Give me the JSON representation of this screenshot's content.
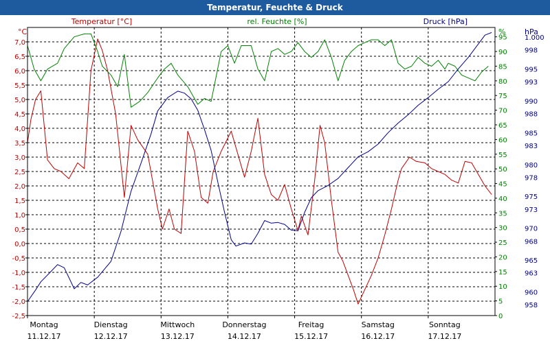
{
  "window_title": "Temperatur, Feuchte & Druck",
  "chart_data": {
    "type": "line",
    "title": "Temperatur, Feuchte & Druck",
    "grid": true,
    "x_range": [
      0,
      7
    ],
    "days": [
      {
        "name": "Montag",
        "date": "11.12.17"
      },
      {
        "name": "Dienstag",
        "date": "12.12.17"
      },
      {
        "name": "Mittwoch",
        "date": "13.12.17"
      },
      {
        "name": "Donnerstag",
        "date": "14.12.17"
      },
      {
        "name": "Freitag",
        "date": "15.12.17"
      },
      {
        "name": "Samstag",
        "date": "16.12.17"
      },
      {
        "name": "Sonntag",
        "date": "17.12.17"
      }
    ],
    "axes": {
      "temperature": {
        "unit": "°C",
        "range": [
          -2.5,
          7.5
        ],
        "ticks": [
          "7,0",
          "6,5",
          "6,0",
          "5,5",
          "5,0",
          "4,5",
          "4,0",
          "3,5",
          "3,0",
          "2,5",
          "2,0",
          "1,5",
          "1,0",
          "0,5",
          "0,0",
          "-0,5",
          "-1,0",
          "-1,5",
          "-2,0",
          "-2,5"
        ],
        "color": "#c00000"
      },
      "humidity": {
        "unit": "%",
        "range": [
          0,
          98.2
        ],
        "ticks": [
          "95",
          "90",
          "85",
          "80",
          "75",
          "70",
          "65",
          "60",
          "55",
          "50",
          "45",
          "40",
          "35",
          "30",
          "25",
          "20",
          "15",
          "10",
          "5",
          "0"
        ],
        "color": "#008000"
      },
      "pressure": {
        "unit": "hPa",
        "range": [
          956.3,
          1001.5
        ],
        "ticks": [
          "1.000",
          "998",
          "995",
          "993",
          "990",
          "988",
          "985",
          "983",
          "980",
          "978",
          "975",
          "973",
          "970",
          "968",
          "965",
          "963",
          "960",
          "958"
        ],
        "color": "#00008b"
      }
    },
    "series": [
      {
        "name": "Temperatur [°C]",
        "axis": "temperature",
        "color": "#c00000",
        "x": [
          0,
          0.05,
          0.12,
          0.2,
          0.3,
          0.4,
          0.5,
          0.62,
          0.75,
          0.85,
          0.95,
          1.05,
          1.12,
          1.2,
          1.32,
          1.45,
          1.55,
          1.65,
          1.8,
          1.95,
          2.02,
          2.12,
          2.2,
          2.3,
          2.4,
          2.5,
          2.6,
          2.7,
          2.78,
          2.9,
          3.05,
          3.15,
          3.25,
          3.35,
          3.45,
          3.55,
          3.65,
          3.75,
          3.85,
          3.95,
          4.05,
          4.1,
          4.2,
          4.3,
          4.38,
          4.45,
          4.55,
          4.65,
          4.72,
          4.8,
          4.88,
          4.95,
          5.05,
          5.15,
          5.25,
          5.35,
          5.45,
          5.55,
          5.6,
          5.72,
          5.82,
          5.95,
          6.05,
          6.15,
          6.25,
          6.35,
          6.45,
          6.55,
          6.65,
          6.75,
          6.85,
          6.95
        ],
        "values": [
          3.5,
          4.3,
          5.0,
          5.3,
          2.9,
          2.6,
          2.5,
          2.25,
          2.8,
          2.6,
          6.0,
          7.1,
          6.7,
          6.0,
          4.5,
          1.6,
          4.1,
          3.6,
          3.1,
          1.2,
          0.5,
          1.2,
          0.5,
          0.35,
          3.9,
          3.2,
          1.6,
          1.4,
          2.5,
          3.2,
          3.9,
          3.1,
          2.3,
          3.2,
          4.35,
          2.4,
          1.7,
          1.5,
          2.05,
          1.2,
          0.45,
          0.95,
          0.3,
          2.2,
          4.1,
          3.5,
          1.5,
          -0.3,
          -0.6,
          -1.1,
          -1.6,
          -2.1,
          -1.6,
          -1.1,
          -0.5,
          0.3,
          1.2,
          2.2,
          2.6,
          3.0,
          2.85,
          2.8,
          2.6,
          2.5,
          2.4,
          2.2,
          2.1,
          2.85,
          2.8,
          2.4,
          2.0,
          1.7
        ]
      },
      {
        "name": "rel. Feuchte [%]",
        "axis": "humidity",
        "color": "#008000",
        "x": [
          0,
          0.1,
          0.2,
          0.3,
          0.45,
          0.55,
          0.7,
          0.85,
          0.95,
          1.05,
          1.12,
          1.25,
          1.35,
          1.45,
          1.55,
          1.68,
          1.8,
          1.95,
          2.05,
          2.15,
          2.25,
          2.4,
          2.55,
          2.65,
          2.75,
          2.9,
          3.0,
          3.1,
          3.2,
          3.35,
          3.45,
          3.55,
          3.65,
          3.75,
          3.85,
          3.95,
          4.05,
          4.15,
          4.25,
          4.35,
          4.45,
          4.55,
          4.65,
          4.75,
          4.85,
          4.95,
          5.05,
          5.15,
          5.25,
          5.35,
          5.45,
          5.55,
          5.65,
          5.75,
          5.85,
          5.95,
          6.05,
          6.15,
          6.25,
          6.3,
          6.4,
          6.5,
          6.6,
          6.7,
          6.8,
          6.9
        ],
        "values": [
          92,
          84,
          80,
          84,
          86,
          91,
          95,
          96,
          96,
          90,
          85,
          82,
          78,
          89,
          71,
          73,
          76,
          81,
          84,
          86,
          82,
          78,
          72,
          74,
          73,
          90,
          92,
          86,
          92,
          92,
          84,
          80,
          90,
          91,
          89,
          90,
          93,
          90,
          88,
          90,
          94,
          88,
          80,
          87,
          90,
          92,
          93,
          94,
          94,
          92,
          94,
          86,
          84,
          85,
          88,
          86,
          85,
          87,
          84,
          86,
          85,
          82,
          81,
          80,
          83,
          85
        ]
      },
      {
        "name": "Druck [hPa]",
        "axis": "pressure",
        "color": "#00008b",
        "x": [
          0,
          0.12,
          0.2,
          0.35,
          0.45,
          0.55,
          0.7,
          0.8,
          0.9,
          1.05,
          1.25,
          1.4,
          1.55,
          1.7,
          1.85,
          1.95,
          2.1,
          2.25,
          2.35,
          2.45,
          2.55,
          2.65,
          2.75,
          2.85,
          2.95,
          3.05,
          3.12,
          3.25,
          3.35,
          3.45,
          3.55,
          3.65,
          3.75,
          3.85,
          3.95,
          4.05,
          4.15,
          4.25,
          4.35,
          4.5,
          4.65,
          4.8,
          4.95,
          5.1,
          5.25,
          5.4,
          5.55,
          5.7,
          5.85,
          6.0,
          6.15,
          6.3,
          6.45,
          6.6,
          6.75,
          6.85,
          6.95
        ],
        "values": [
          958.5,
          960.3,
          961.6,
          963.2,
          964.3,
          963.8,
          960.5,
          961.5,
          961.1,
          962.3,
          964.8,
          969.5,
          975.8,
          980.2,
          984.8,
          988.4,
          990.5,
          991.5,
          991.2,
          990.3,
          988.5,
          985.5,
          982.2,
          977.2,
          972.5,
          968.2,
          967.2,
          967.7,
          967.5,
          969.2,
          971.2,
          970.8,
          970.9,
          970.6,
          969.7,
          969.6,
          972.5,
          974.8,
          975.9,
          976.7,
          977.8,
          979.5,
          981.2,
          982.0,
          983.2,
          985.0,
          986.5,
          987.8,
          989.3,
          990.5,
          991.8,
          993.0,
          995.0,
          996.8,
          998.9,
          1000.3,
          1000.7
        ]
      }
    ]
  }
}
